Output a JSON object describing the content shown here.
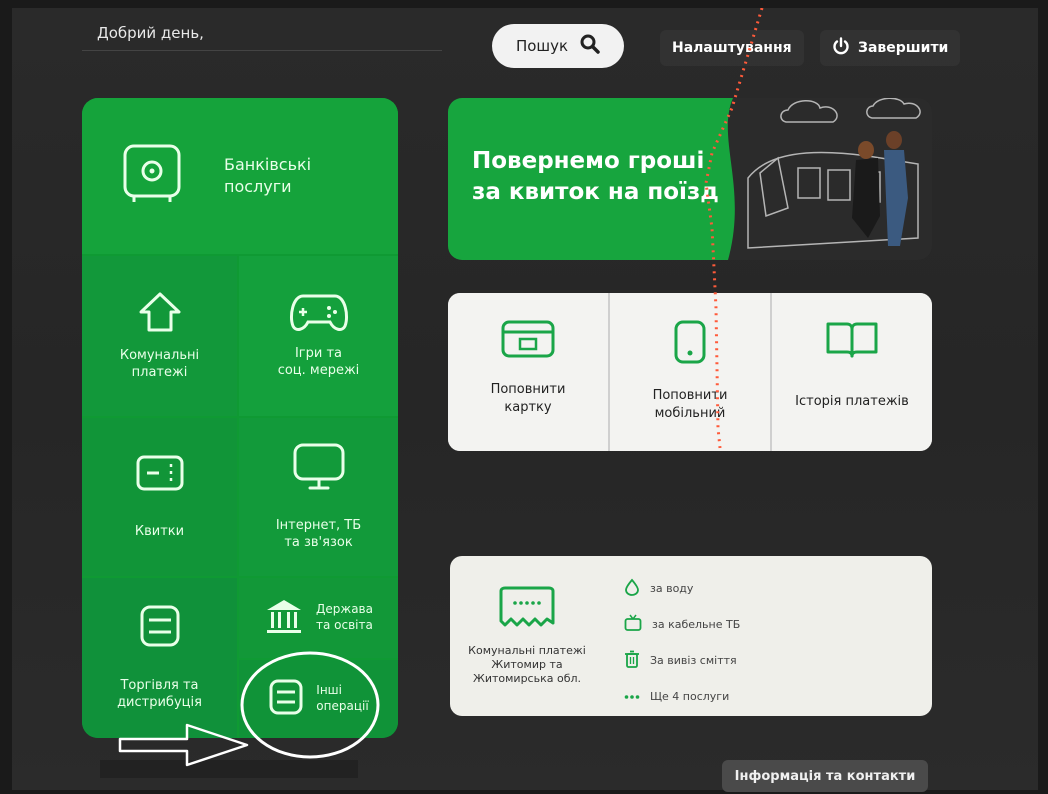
{
  "header": {
    "greeting": "Добрий день,",
    "search_label": "Пошук",
    "settings_label": "Налаштування",
    "exit_label": "Завершити"
  },
  "tiles": {
    "bank": "Банківські\nпослуги",
    "utilities": "Комунальні\nплатежі",
    "games": "Ігри та\nсоц. мережі",
    "tickets": "Квитки",
    "internet": "Інтернет, ТБ\nта зв'язок",
    "trade": "Торгівля та\nдистрибуція",
    "gov": "Держава\nта освіта",
    "other": "Інші\nоперації"
  },
  "banner": {
    "text": "Повернемо гроші\nза квиток на поїзд"
  },
  "cards": [
    {
      "label": "Поповнити\nкартку"
    },
    {
      "label": "Поповнити\nмобільний"
    },
    {
      "label": "Історія платежів"
    }
  ],
  "utility_card": {
    "title": "Комунальні платежі\nЖитомир та\nЖитомирська обл.",
    "items": [
      {
        "label": "за воду"
      },
      {
        "label": "за кабельне ТБ"
      },
      {
        "label": "За вивіз сміття"
      },
      {
        "label": "Ще 4 послуги"
      }
    ]
  },
  "footer": {
    "info_label": "Інформація та контакти"
  },
  "colors": {
    "brand_green": "#14a23a",
    "card_bg": "#f3f3f1",
    "icon_green": "#1aa548",
    "background": "#272727"
  }
}
